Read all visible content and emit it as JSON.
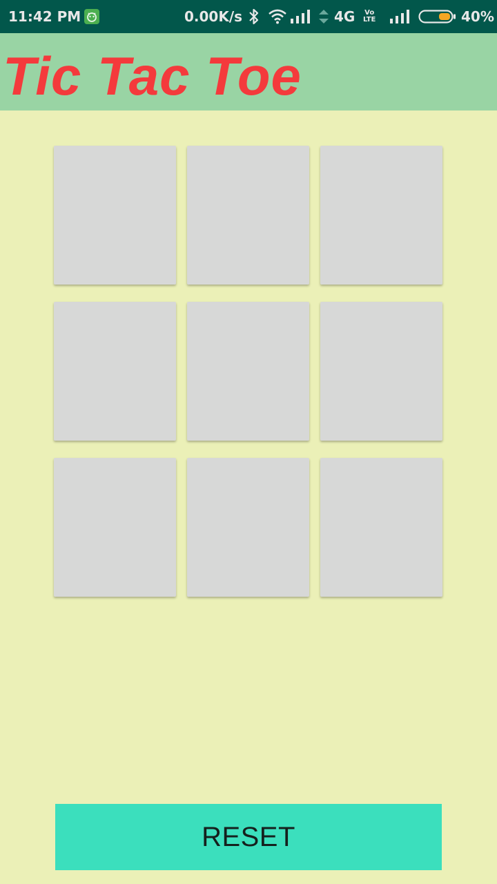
{
  "status_bar": {
    "time": "11:42 PM",
    "net_speed": "0.00K/s",
    "network_type": "4G",
    "volte_top": "Vo",
    "volte_bottom": "LTE",
    "battery_percent_text": "40%",
    "battery_level": 0.4,
    "battery_color": "#f5a623",
    "icons": [
      "app-notification-icon",
      "bluetooth-icon",
      "wifi-icon",
      "signal-icon",
      "data-arrows-icon",
      "signal-icon",
      "battery-icon"
    ]
  },
  "header": {
    "title": "Tic Tac Toe",
    "title_color": "#f43a3c",
    "background": "#99d4a4"
  },
  "board": {
    "cells": [
      "",
      "",
      "",
      "",
      "",
      "",
      "",
      "",
      ""
    ],
    "cell_color": "#d7d8d7"
  },
  "actions": {
    "reset_label": "RESET",
    "reset_color": "#3bdfbd"
  },
  "colors": {
    "page_background": "#ebf0b7",
    "status_bar": "#02574b"
  }
}
